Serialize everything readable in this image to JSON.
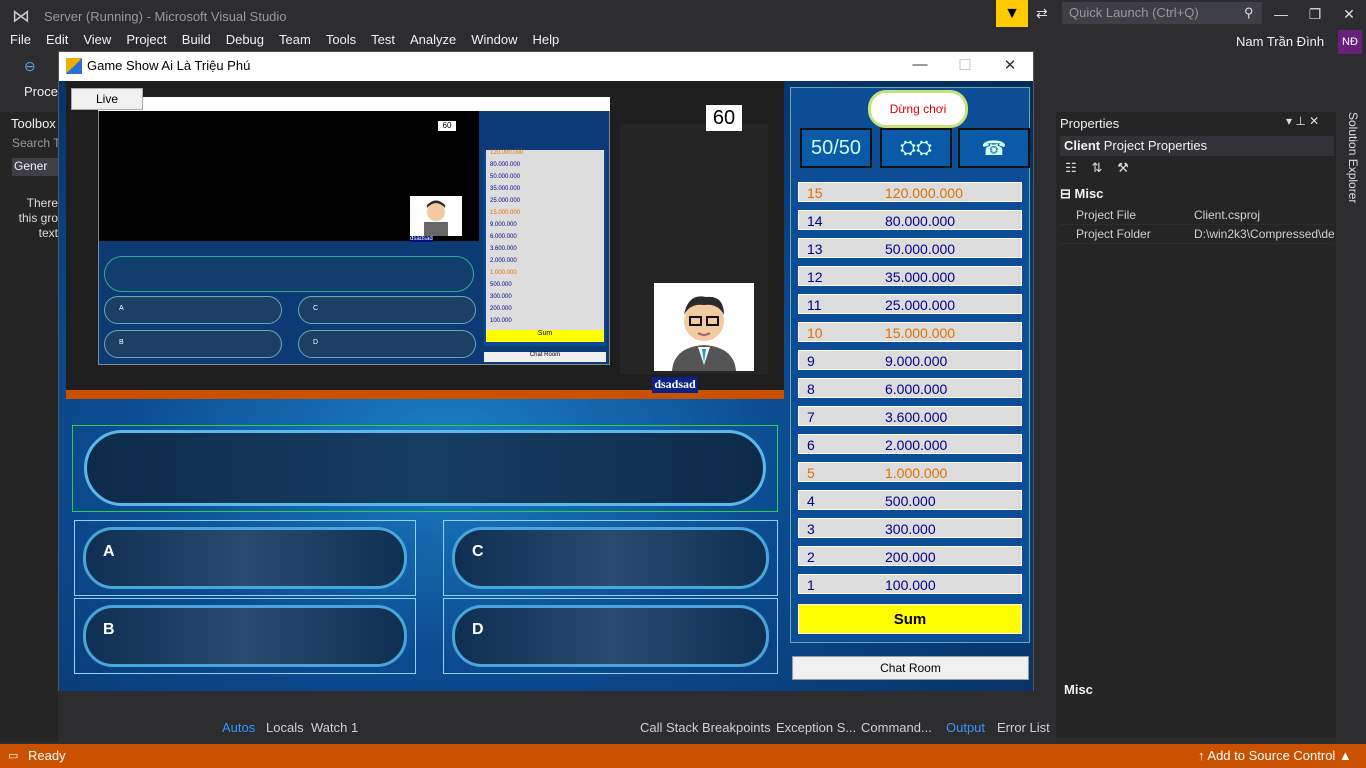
{
  "vs": {
    "title": "Server (Running) - Microsoft Visual Studio",
    "quick_launch_placeholder": "Quick Launch (Ctrl+Q)",
    "menu": [
      "File",
      "Edit",
      "View",
      "Project",
      "Build",
      "Debug",
      "Team",
      "Tools",
      "Test",
      "Analyze",
      "Window",
      "Help"
    ],
    "user": "Nam Trần Đình",
    "avatar_initials": "NĐ",
    "process_label": "Proces",
    "toolbox": {
      "title": "Toolbox",
      "search": "Search T",
      "group": "Gener",
      "empty_text": "There this gro text"
    },
    "properties": {
      "title": "Properties",
      "object_name": "Client",
      "object_type": "Project Properties",
      "category": "Misc",
      "rows": [
        {
          "name": "Project File",
          "value": "Client.csproj"
        },
        {
          "name": "Project Folder",
          "value": "D:\\win2k3\\Compressed\\de"
        }
      ],
      "description_title": "Misc"
    },
    "solution_explorer": "Solution Explorer",
    "bottom_tabs_left": [
      "Autos",
      "Locals",
      "Watch 1"
    ],
    "bottom_tabs_right": [
      "Call Stack",
      "Breakpoints",
      "Exception S...",
      "Command...",
      "Output",
      "Error List"
    ],
    "status": "Ready",
    "source_control": "Add to Source Control"
  },
  "game": {
    "window_title": "Game Show Ai Là Triệu Phú",
    "live_button": "Live",
    "timer": "60",
    "host_name": "dsadsad",
    "stop_button": "Dừng chơi",
    "lifeline_5050": "50/50",
    "answers": {
      "a": "A",
      "b": "B",
      "c": "C",
      "d": "D"
    },
    "ladder": [
      {
        "n": "15",
        "amount": "120.000.000",
        "milestone": true
      },
      {
        "n": "14",
        "amount": "80.000.000",
        "milestone": false
      },
      {
        "n": "13",
        "amount": "50.000.000",
        "milestone": false
      },
      {
        "n": "12",
        "amount": "35.000.000",
        "milestone": false
      },
      {
        "n": "11",
        "amount": "25.000.000",
        "milestone": false
      },
      {
        "n": "10",
        "amount": "15.000.000",
        "milestone": true
      },
      {
        "n": "9",
        "amount": "9.000.000",
        "milestone": false
      },
      {
        "n": "8",
        "amount": "6.000.000",
        "milestone": false
      },
      {
        "n": "7",
        "amount": "3.600.000",
        "milestone": false
      },
      {
        "n": "6",
        "amount": "2.000.000",
        "milestone": false
      },
      {
        "n": "5",
        "amount": "1.000.000",
        "milestone": true
      },
      {
        "n": "4",
        "amount": "500.000",
        "milestone": false
      },
      {
        "n": "3",
        "amount": "300.000",
        "milestone": false
      },
      {
        "n": "2",
        "amount": "200.000",
        "milestone": false
      },
      {
        "n": "1",
        "amount": "100.000",
        "milestone": false
      }
    ],
    "sum_button": "Sum",
    "chat_button": "Chat Room",
    "colors": {
      "milestone": "#e07000",
      "normal": "#00008b",
      "sum": "#ffff00",
      "status": "#ca5100"
    }
  }
}
